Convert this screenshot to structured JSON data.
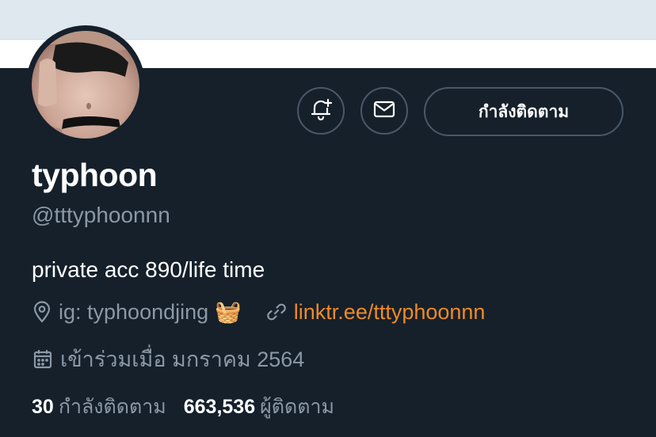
{
  "profile": {
    "display_name": "typhoon",
    "handle": "@tttyphoonnn",
    "bio": "private acc 890/life time",
    "location": "ig: typhoondjing",
    "location_emoji": "🧺",
    "link": "linktr.ee/tttyphoonnn",
    "joined": "เข้าร่วมเมื่อ มกราคม 2564"
  },
  "actions": {
    "notify_icon": "bell-plus-icon",
    "message_icon": "envelope-icon",
    "follow_label": "กำลังติดตาม"
  },
  "stats": {
    "following_count": "30",
    "following_label": "กำลังติดตาม",
    "followers_count": "663,536",
    "followers_label": "ผู้ติดตาม"
  },
  "colors": {
    "background": "#15202b",
    "muted_text": "#8b98a5",
    "link": "#f08a24",
    "border": "#4a5866"
  }
}
